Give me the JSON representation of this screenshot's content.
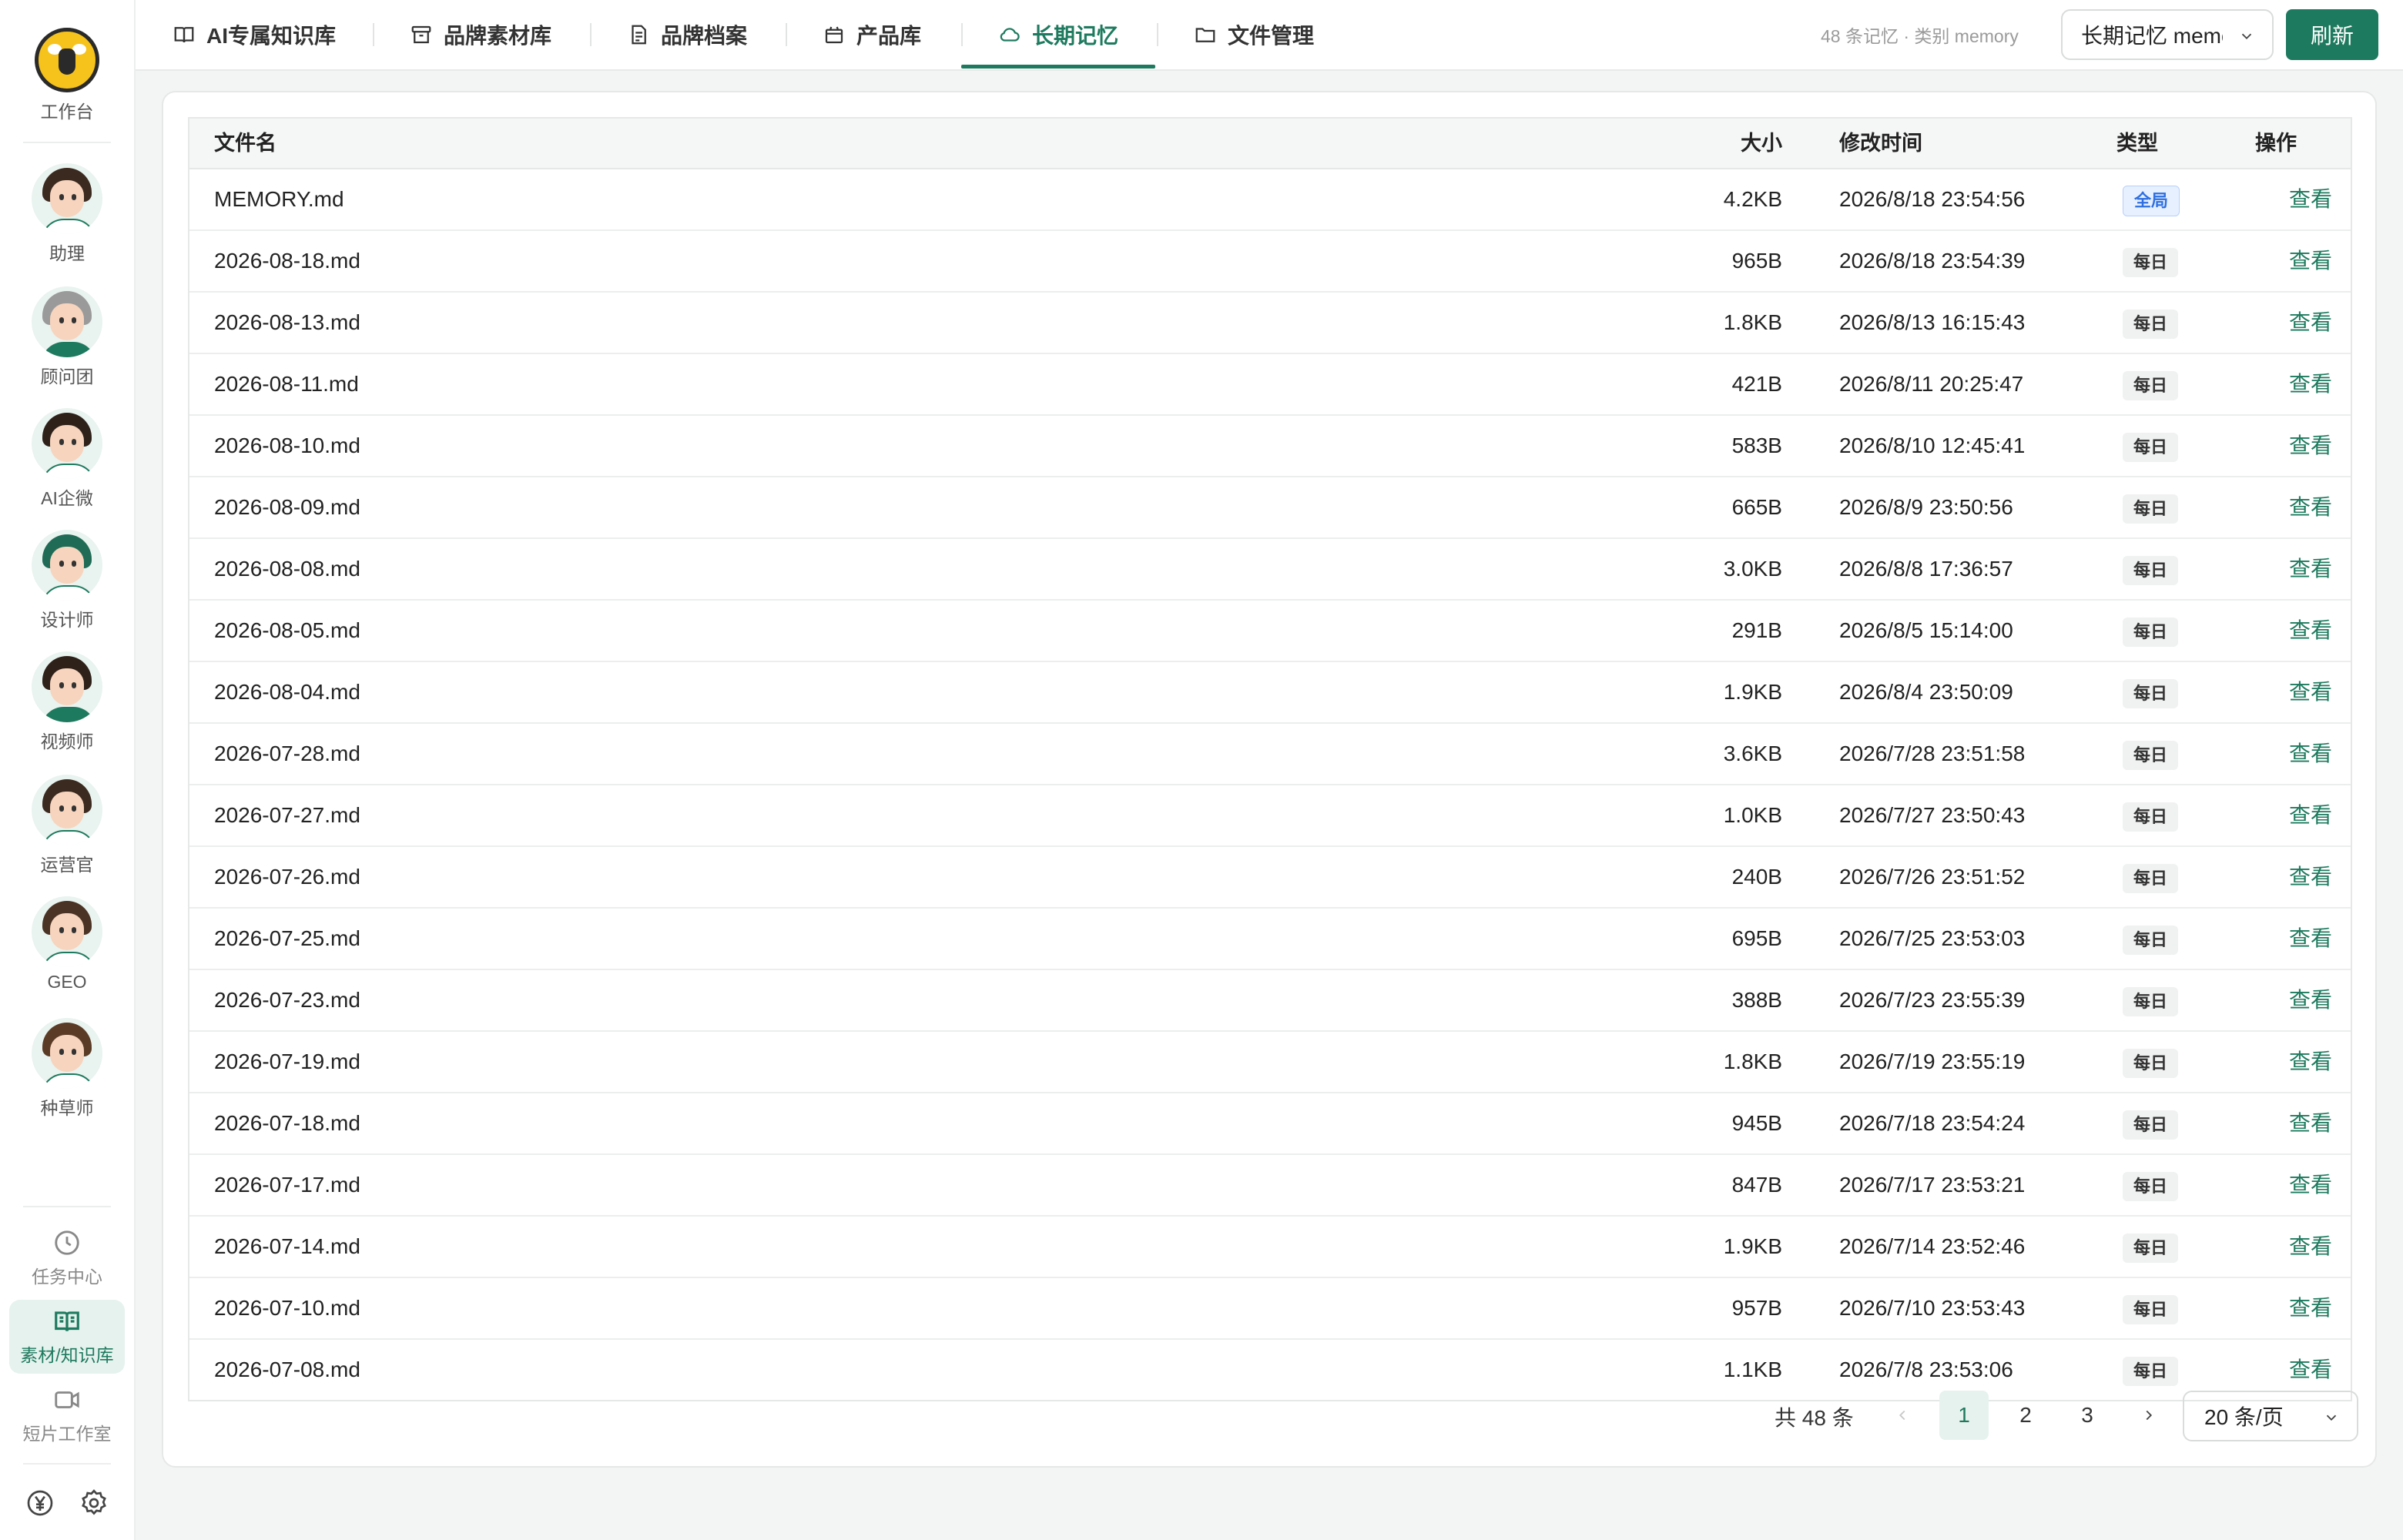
{
  "sidebar": {
    "workbench_label": "工作台",
    "agents": [
      {
        "label": "助理"
      },
      {
        "label": "顾问团"
      },
      {
        "label": "AI企微"
      },
      {
        "label": "设计师"
      },
      {
        "label": "视频师"
      },
      {
        "label": "运营官"
      },
      {
        "label": "GEO"
      },
      {
        "label": "种草师"
      }
    ],
    "nav": [
      {
        "label": "任务中心",
        "icon": "clock-icon"
      },
      {
        "label": "素材/知识库",
        "icon": "book-icon",
        "active": true
      },
      {
        "label": "短片工作室",
        "icon": "video-camera-icon"
      }
    ],
    "bottom_icons": [
      "yen-icon",
      "gear-icon"
    ]
  },
  "topbar": {
    "tabs": [
      {
        "label": "AI专属知识库",
        "icon": "book-icon"
      },
      {
        "label": "品牌素材库",
        "icon": "archive-icon"
      },
      {
        "label": "品牌档案",
        "icon": "document-icon"
      },
      {
        "label": "产品库",
        "icon": "box-icon"
      },
      {
        "label": "长期记忆",
        "icon": "cloud-icon",
        "active": true
      },
      {
        "label": "文件管理",
        "icon": "folder-icon"
      }
    ],
    "meta": "48 条记忆 · 类别 memory",
    "select_value": "长期记忆 memory",
    "refresh_label": "刷新"
  },
  "table": {
    "headers": {
      "name": "文件名",
      "size": "大小",
      "time": "修改时间",
      "type": "类型",
      "action": "操作"
    },
    "rows": [
      {
        "name": "MEMORY.md",
        "size": "4.2KB",
        "time": "2026/8/18 23:54:56",
        "type": "全局",
        "action": "查看"
      },
      {
        "name": "2026-08-18.md",
        "size": "965B",
        "time": "2026/8/18 23:54:39",
        "type": "每日",
        "action": "查看"
      },
      {
        "name": "2026-08-13.md",
        "size": "1.8KB",
        "time": "2026/8/13 16:15:43",
        "type": "每日",
        "action": "查看"
      },
      {
        "name": "2026-08-11.md",
        "size": "421B",
        "time": "2026/8/11 20:25:47",
        "type": "每日",
        "action": "查看"
      },
      {
        "name": "2026-08-10.md",
        "size": "583B",
        "time": "2026/8/10 12:45:41",
        "type": "每日",
        "action": "查看"
      },
      {
        "name": "2026-08-09.md",
        "size": "665B",
        "time": "2026/8/9 23:50:56",
        "type": "每日",
        "action": "查看"
      },
      {
        "name": "2026-08-08.md",
        "size": "3.0KB",
        "time": "2026/8/8 17:36:57",
        "type": "每日",
        "action": "查看"
      },
      {
        "name": "2026-08-05.md",
        "size": "291B",
        "time": "2026/8/5 15:14:00",
        "type": "每日",
        "action": "查看"
      },
      {
        "name": "2026-08-04.md",
        "size": "1.9KB",
        "time": "2026/8/4 23:50:09",
        "type": "每日",
        "action": "查看"
      },
      {
        "name": "2026-07-28.md",
        "size": "3.6KB",
        "time": "2026/7/28 23:51:58",
        "type": "每日",
        "action": "查看"
      },
      {
        "name": "2026-07-27.md",
        "size": "1.0KB",
        "time": "2026/7/27 23:50:43",
        "type": "每日",
        "action": "查看"
      },
      {
        "name": "2026-07-26.md",
        "size": "240B",
        "time": "2026/7/26 23:51:52",
        "type": "每日",
        "action": "查看"
      },
      {
        "name": "2026-07-25.md",
        "size": "695B",
        "time": "2026/7/25 23:53:03",
        "type": "每日",
        "action": "查看"
      },
      {
        "name": "2026-07-23.md",
        "size": "388B",
        "time": "2026/7/23 23:55:39",
        "type": "每日",
        "action": "查看"
      },
      {
        "name": "2026-07-19.md",
        "size": "1.8KB",
        "time": "2026/7/19 23:55:19",
        "type": "每日",
        "action": "查看"
      },
      {
        "name": "2026-07-18.md",
        "size": "945B",
        "time": "2026/7/18 23:54:24",
        "type": "每日",
        "action": "查看"
      },
      {
        "name": "2026-07-17.md",
        "size": "847B",
        "time": "2026/7/17 23:53:21",
        "type": "每日",
        "action": "查看"
      },
      {
        "name": "2026-07-14.md",
        "size": "1.9KB",
        "time": "2026/7/14 23:52:46",
        "type": "每日",
        "action": "查看"
      },
      {
        "name": "2026-07-10.md",
        "size": "957B",
        "time": "2026/7/10 23:53:43",
        "type": "每日",
        "action": "查看"
      },
      {
        "name": "2026-07-08.md",
        "size": "1.1KB",
        "time": "2026/7/8 23:53:06",
        "type": "每日",
        "action": "查看"
      }
    ]
  },
  "pagination": {
    "total": "共 48 条",
    "pages": [
      "1",
      "2",
      "3"
    ],
    "current": "1",
    "page_size": "20 条/页"
  },
  "colors": {
    "accent": "#1e7a5e",
    "global_tag": "#2f6fe0"
  }
}
